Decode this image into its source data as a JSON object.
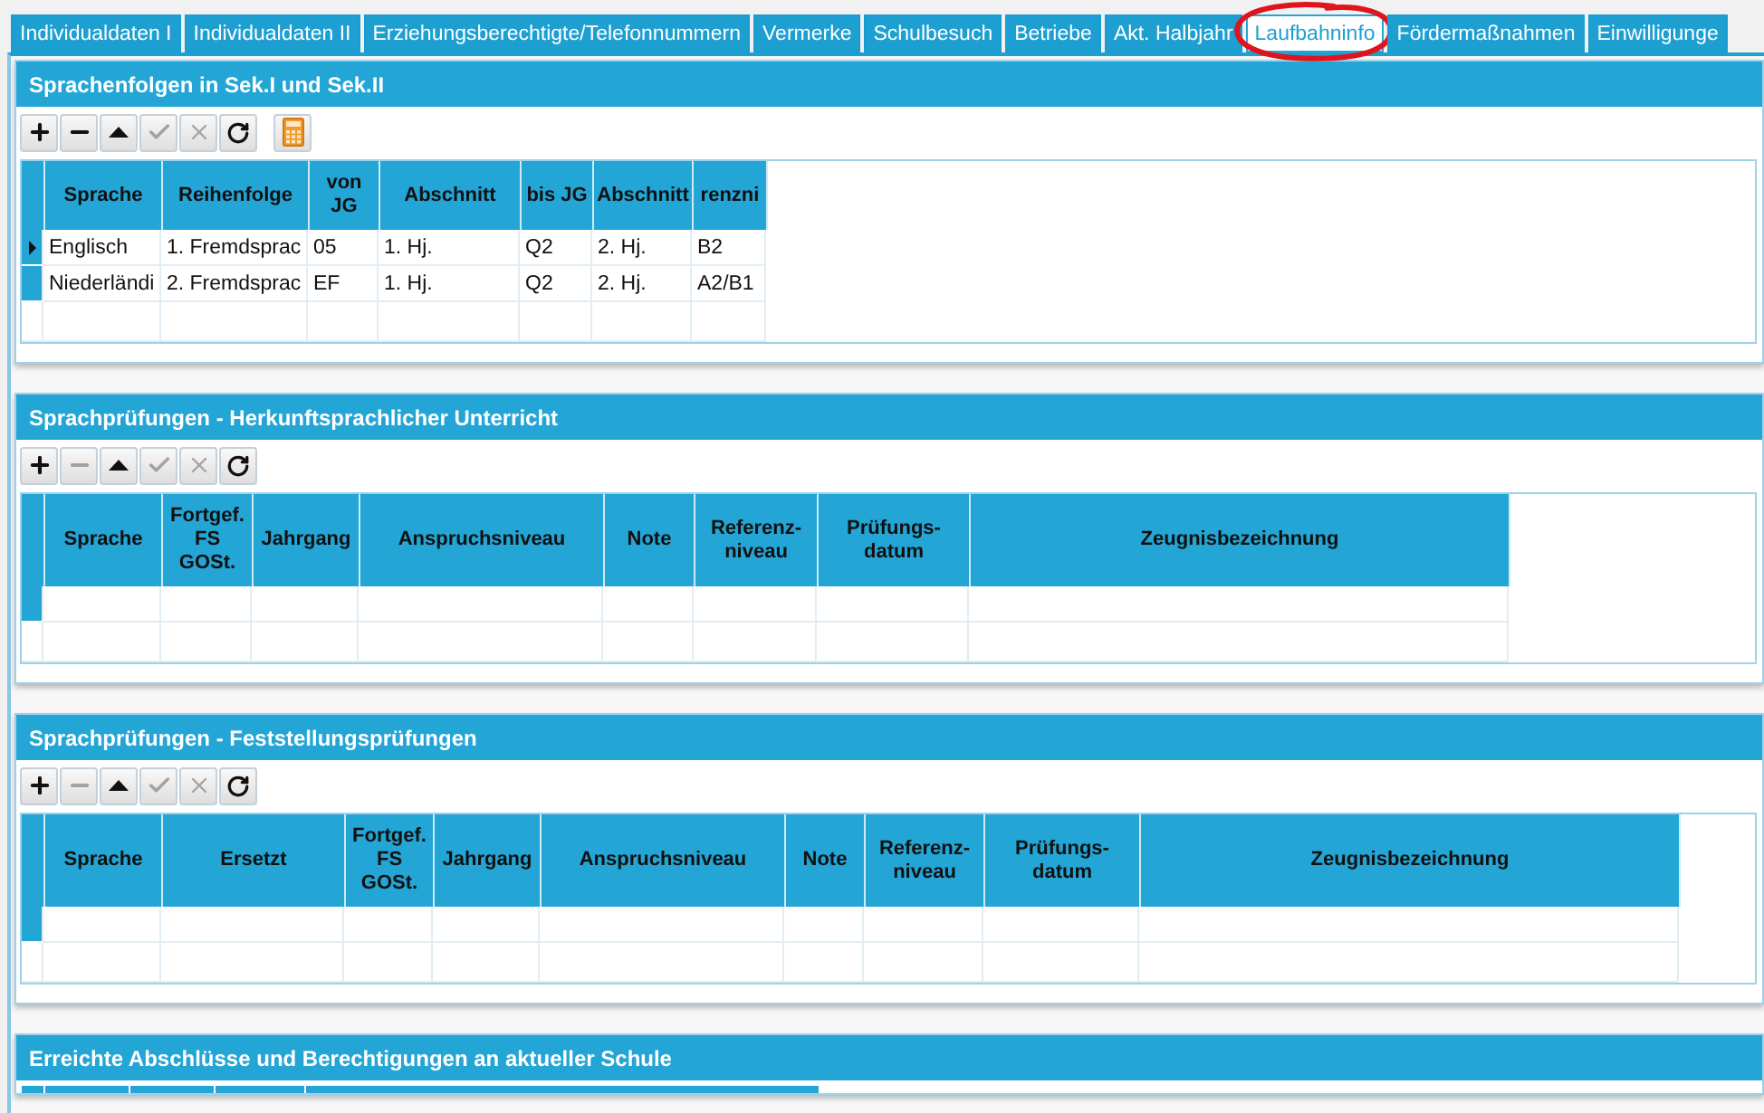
{
  "tabs": [
    {
      "label": "Individualdaten I",
      "selected": false,
      "circled": false
    },
    {
      "label": "Individualdaten II",
      "selected": false,
      "circled": false
    },
    {
      "label": "Erziehungsberechtigte/Telefonnummern",
      "selected": false,
      "circled": false
    },
    {
      "label": "Vermerke",
      "selected": false,
      "circled": false
    },
    {
      "label": "Schulbesuch",
      "selected": false,
      "circled": false
    },
    {
      "label": "Betriebe",
      "selected": false,
      "circled": false
    },
    {
      "label": "Akt. Halbjahr",
      "selected": false,
      "circled": false
    },
    {
      "label": "Laufbahninfo",
      "selected": true,
      "circled": true
    },
    {
      "label": "Fördermaßnahmen",
      "selected": false,
      "circled": false
    },
    {
      "label": "Einwilligunge",
      "selected": false,
      "circled": false
    }
  ],
  "sections": [
    {
      "kind": "grid",
      "title": "Sprachenfolgen in Sek.I und Sek.II",
      "toolbar": [
        {
          "kind": "add",
          "disabled": false
        },
        {
          "kind": "remove",
          "disabled": false
        },
        {
          "kind": "move-up",
          "disabled": false
        },
        {
          "kind": "confirm",
          "disabled": true
        },
        {
          "kind": "cancel",
          "disabled": true
        },
        {
          "kind": "refresh",
          "disabled": false
        },
        {
          "kind": "calculator",
          "disabled": false
        }
      ],
      "table": {
        "columns": [
          "Sprache",
          "Reihenfolge",
          "von JG",
          "Abschnitt",
          "bis JG",
          "Abschnitt",
          "renzni"
        ],
        "rows": [
          {
            "selected": true,
            "cells": [
              "Englisch",
              "1. Fremdsprac",
              "05",
              "1. Hj.",
              "Q2",
              "2. Hj.",
              "B2"
            ]
          },
          {
            "selected": false,
            "cells": [
              "Niederländi",
              "2. Fremdsprac",
              "EF",
              "1. Hj.",
              "Q2",
              "2. Hj.",
              "A2/B1"
            ]
          }
        ]
      }
    },
    {
      "kind": "grid",
      "title": "Sprachprüfungen - Herkunftsprachlicher Unterricht",
      "toolbar": [
        {
          "kind": "add",
          "disabled": false
        },
        {
          "kind": "remove",
          "disabled": true
        },
        {
          "kind": "move-up",
          "disabled": false
        },
        {
          "kind": "confirm",
          "disabled": true
        },
        {
          "kind": "cancel",
          "disabled": true
        },
        {
          "kind": "refresh",
          "disabled": false
        }
      ],
      "table": {
        "columns": [
          "Sprache",
          "Fortgef. FS GOSt.",
          "Jahrgang",
          "Anspruchsniveau",
          "Note",
          "Referenz-niveau",
          "Prüfungs-datum",
          "Zeugnisbezeichnung"
        ]
      }
    },
    {
      "kind": "grid",
      "title": "Sprachprüfungen - Feststellungsprüfungen",
      "toolbar": [
        {
          "kind": "add",
          "disabled": false
        },
        {
          "kind": "remove",
          "disabled": true
        },
        {
          "kind": "move-up",
          "disabled": false
        },
        {
          "kind": "confirm",
          "disabled": true
        },
        {
          "kind": "cancel",
          "disabled": true
        },
        {
          "kind": "refresh",
          "disabled": false
        }
      ],
      "table": {
        "columns": [
          "Sprache",
          "Ersetzt",
          "Fortgef. FS GOSt.",
          "Jahrgang",
          "Anspruchsniveau",
          "Note",
          "Referenz-niveau",
          "Prüfungs-datum",
          "Zeugnisbezeichnung"
        ]
      }
    },
    {
      "kind": "clipped",
      "title": "Erreichte Abschlüsse und Berechtigungen an aktueller Schule"
    }
  ]
}
